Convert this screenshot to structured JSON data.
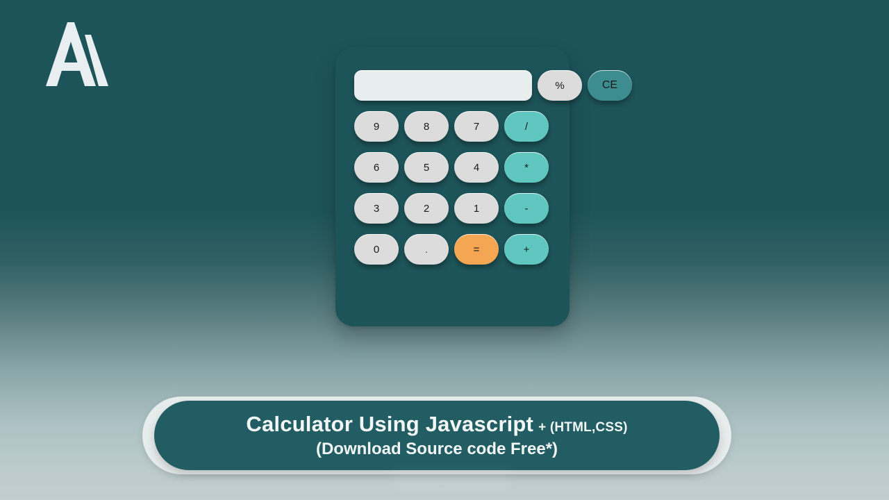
{
  "theme": {
    "bg_top": "#1d5459",
    "bg_bottom": "#c2ced0",
    "panel": "#1d5459",
    "key_bg": "#dcdcdc",
    "operator": "#5fc7c0",
    "clear": "#3d8c90",
    "equals": "#f4a653",
    "display_bg": "#e8eeed",
    "banner_bg": "#215d63",
    "banner_outline": "#e7ecec",
    "text_light": "#f2f7f6"
  },
  "logo": {
    "name": "letter-a-mountain-logo",
    "color": "#e9eff0"
  },
  "calculator": {
    "display": {
      "value": "",
      "placeholder": ""
    },
    "rows": [
      [
        {
          "label": "%",
          "name": "key-percent",
          "kind": "num"
        },
        {
          "label": "CE",
          "name": "key-clear",
          "kind": "clear"
        }
      ],
      [
        {
          "label": "9",
          "name": "key-9",
          "kind": "num"
        },
        {
          "label": "8",
          "name": "key-8",
          "kind": "num"
        },
        {
          "label": "7",
          "name": "key-7",
          "kind": "num"
        },
        {
          "label": "/",
          "name": "key-divide",
          "kind": "op"
        }
      ],
      [
        {
          "label": "6",
          "name": "key-6",
          "kind": "num"
        },
        {
          "label": "5",
          "name": "key-5",
          "kind": "num"
        },
        {
          "label": "4",
          "name": "key-4",
          "kind": "num"
        },
        {
          "label": "*",
          "name": "key-multiply",
          "kind": "op"
        }
      ],
      [
        {
          "label": "3",
          "name": "key-3",
          "kind": "num"
        },
        {
          "label": "2",
          "name": "key-2",
          "kind": "num"
        },
        {
          "label": "1",
          "name": "key-1",
          "kind": "num"
        },
        {
          "label": "-",
          "name": "key-subtract",
          "kind": "op"
        }
      ],
      [
        {
          "label": "0",
          "name": "key-0",
          "kind": "num"
        },
        {
          "label": ".",
          "name": "key-decimal",
          "kind": "dot"
        },
        {
          "label": "=",
          "name": "key-equals",
          "kind": "equals"
        },
        {
          "label": "+",
          "name": "key-add",
          "kind": "op"
        }
      ]
    ]
  },
  "banner": {
    "title_main": "Calculator Using Javascript",
    "title_suffix": "+ (HTML,CSS)",
    "subtitle": "(Download Source code Free*)"
  },
  "bottom_caption": ""
}
